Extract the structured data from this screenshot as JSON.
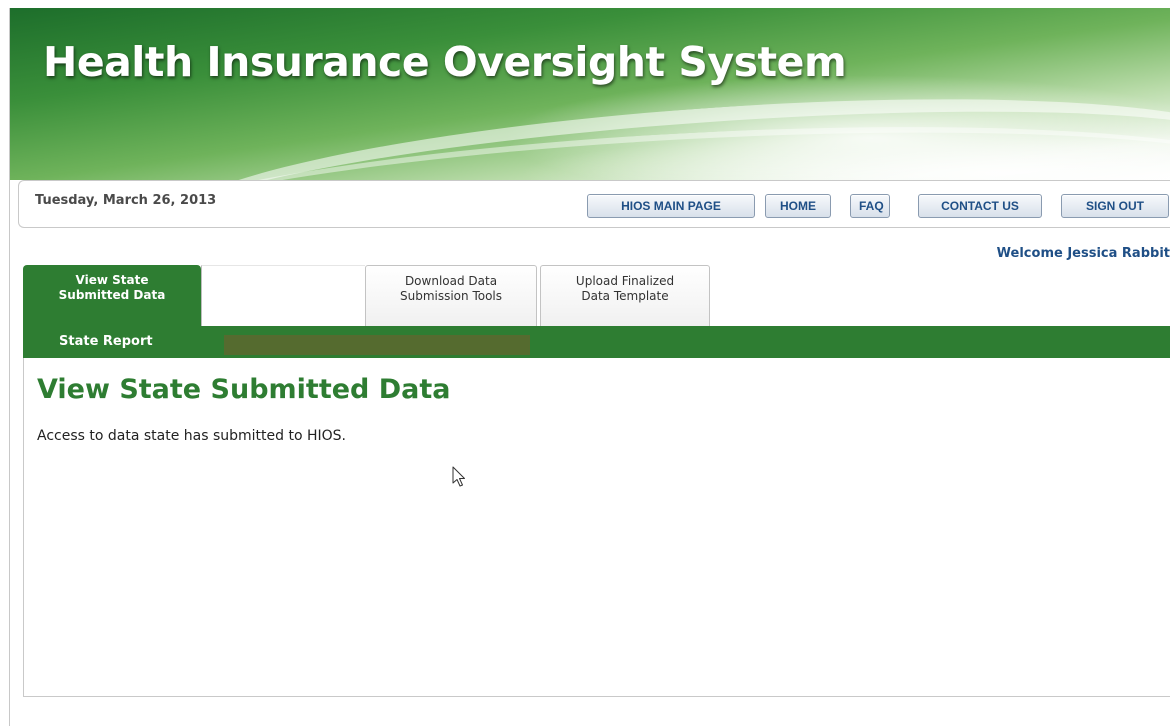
{
  "banner": {
    "title": "Health Insurance Oversight System"
  },
  "topbar": {
    "date": "Tuesday, March 26, 2013",
    "buttons": {
      "main": "HIOS MAIN PAGE",
      "home": "HOME",
      "faq": "FAQ",
      "contact": "CONTACT US",
      "signout": "SIGN OUT"
    }
  },
  "welcome": "Welcome Jessica Rabbit",
  "tabs": {
    "active": {
      "line1": "View State",
      "line2": "Submitted Data"
    },
    "download": {
      "line1": "Download Data",
      "line2": "Submission Tools"
    },
    "upload": {
      "line1": "Upload Finalized",
      "line2": "Data Template"
    }
  },
  "subnav": {
    "item": "State Report"
  },
  "content": {
    "title": "View State Submitted Data",
    "description": "Access to data state has submitted to HIOS."
  },
  "colors": {
    "accent_green": "#2e7d32",
    "link_blue": "#1f4f86",
    "highlight_olive": "#556b2f"
  },
  "icons": {
    "cursor": "mouse-pointer-icon"
  }
}
